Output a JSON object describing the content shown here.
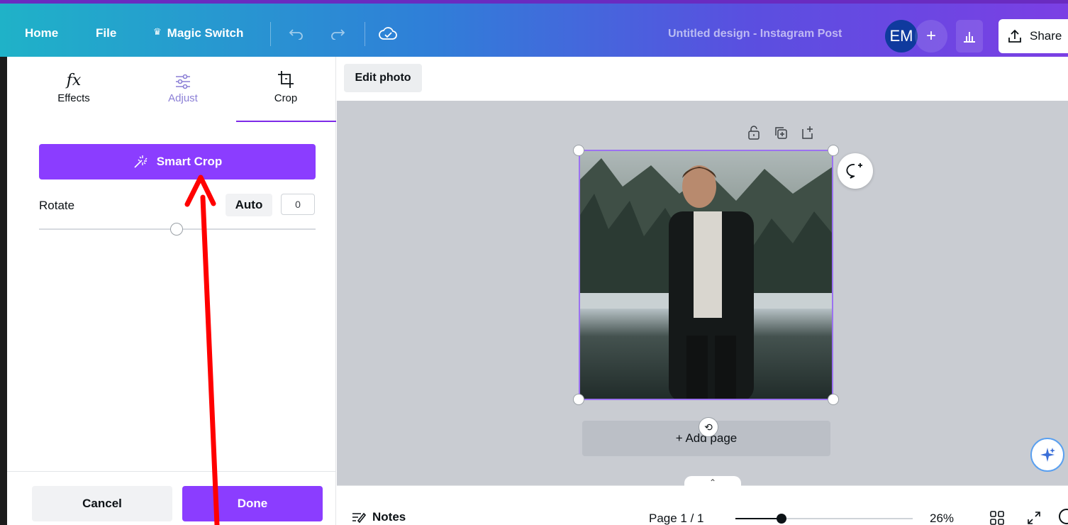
{
  "topbar": {
    "home": "Home",
    "file": "File",
    "magic_switch": "Magic Switch",
    "crown_glyph": "♛",
    "design_title": "Untitled design - Instagram Post",
    "avatar_initials": "EM",
    "add_glyph": "+",
    "share": "Share"
  },
  "panel": {
    "tabs": [
      {
        "label": "Effects",
        "icon": "fx-icon"
      },
      {
        "label": "Adjust",
        "icon": "sliders-icon"
      },
      {
        "label": "Crop",
        "icon": "crop-icon"
      }
    ],
    "active_tab": "Crop",
    "smart_crop": "Smart Crop",
    "rotate_label": "Rotate",
    "auto_label": "Auto",
    "rotate_value": "0",
    "rotate_slider_fraction": 0.5,
    "cancel": "Cancel",
    "done": "Done"
  },
  "canvas": {
    "edit_photo": "Edit photo",
    "add_page": "+ Add page",
    "rotate_glyph": "⟲"
  },
  "bottombar": {
    "collapse_glyph": "⌃",
    "notes": "Notes",
    "page_indicator": "Page 1 / 1",
    "zoom": "26%",
    "zoom_fraction": 0.26
  },
  "colors": {
    "accent": "#8b3dff",
    "arrow": "#ff0000"
  }
}
